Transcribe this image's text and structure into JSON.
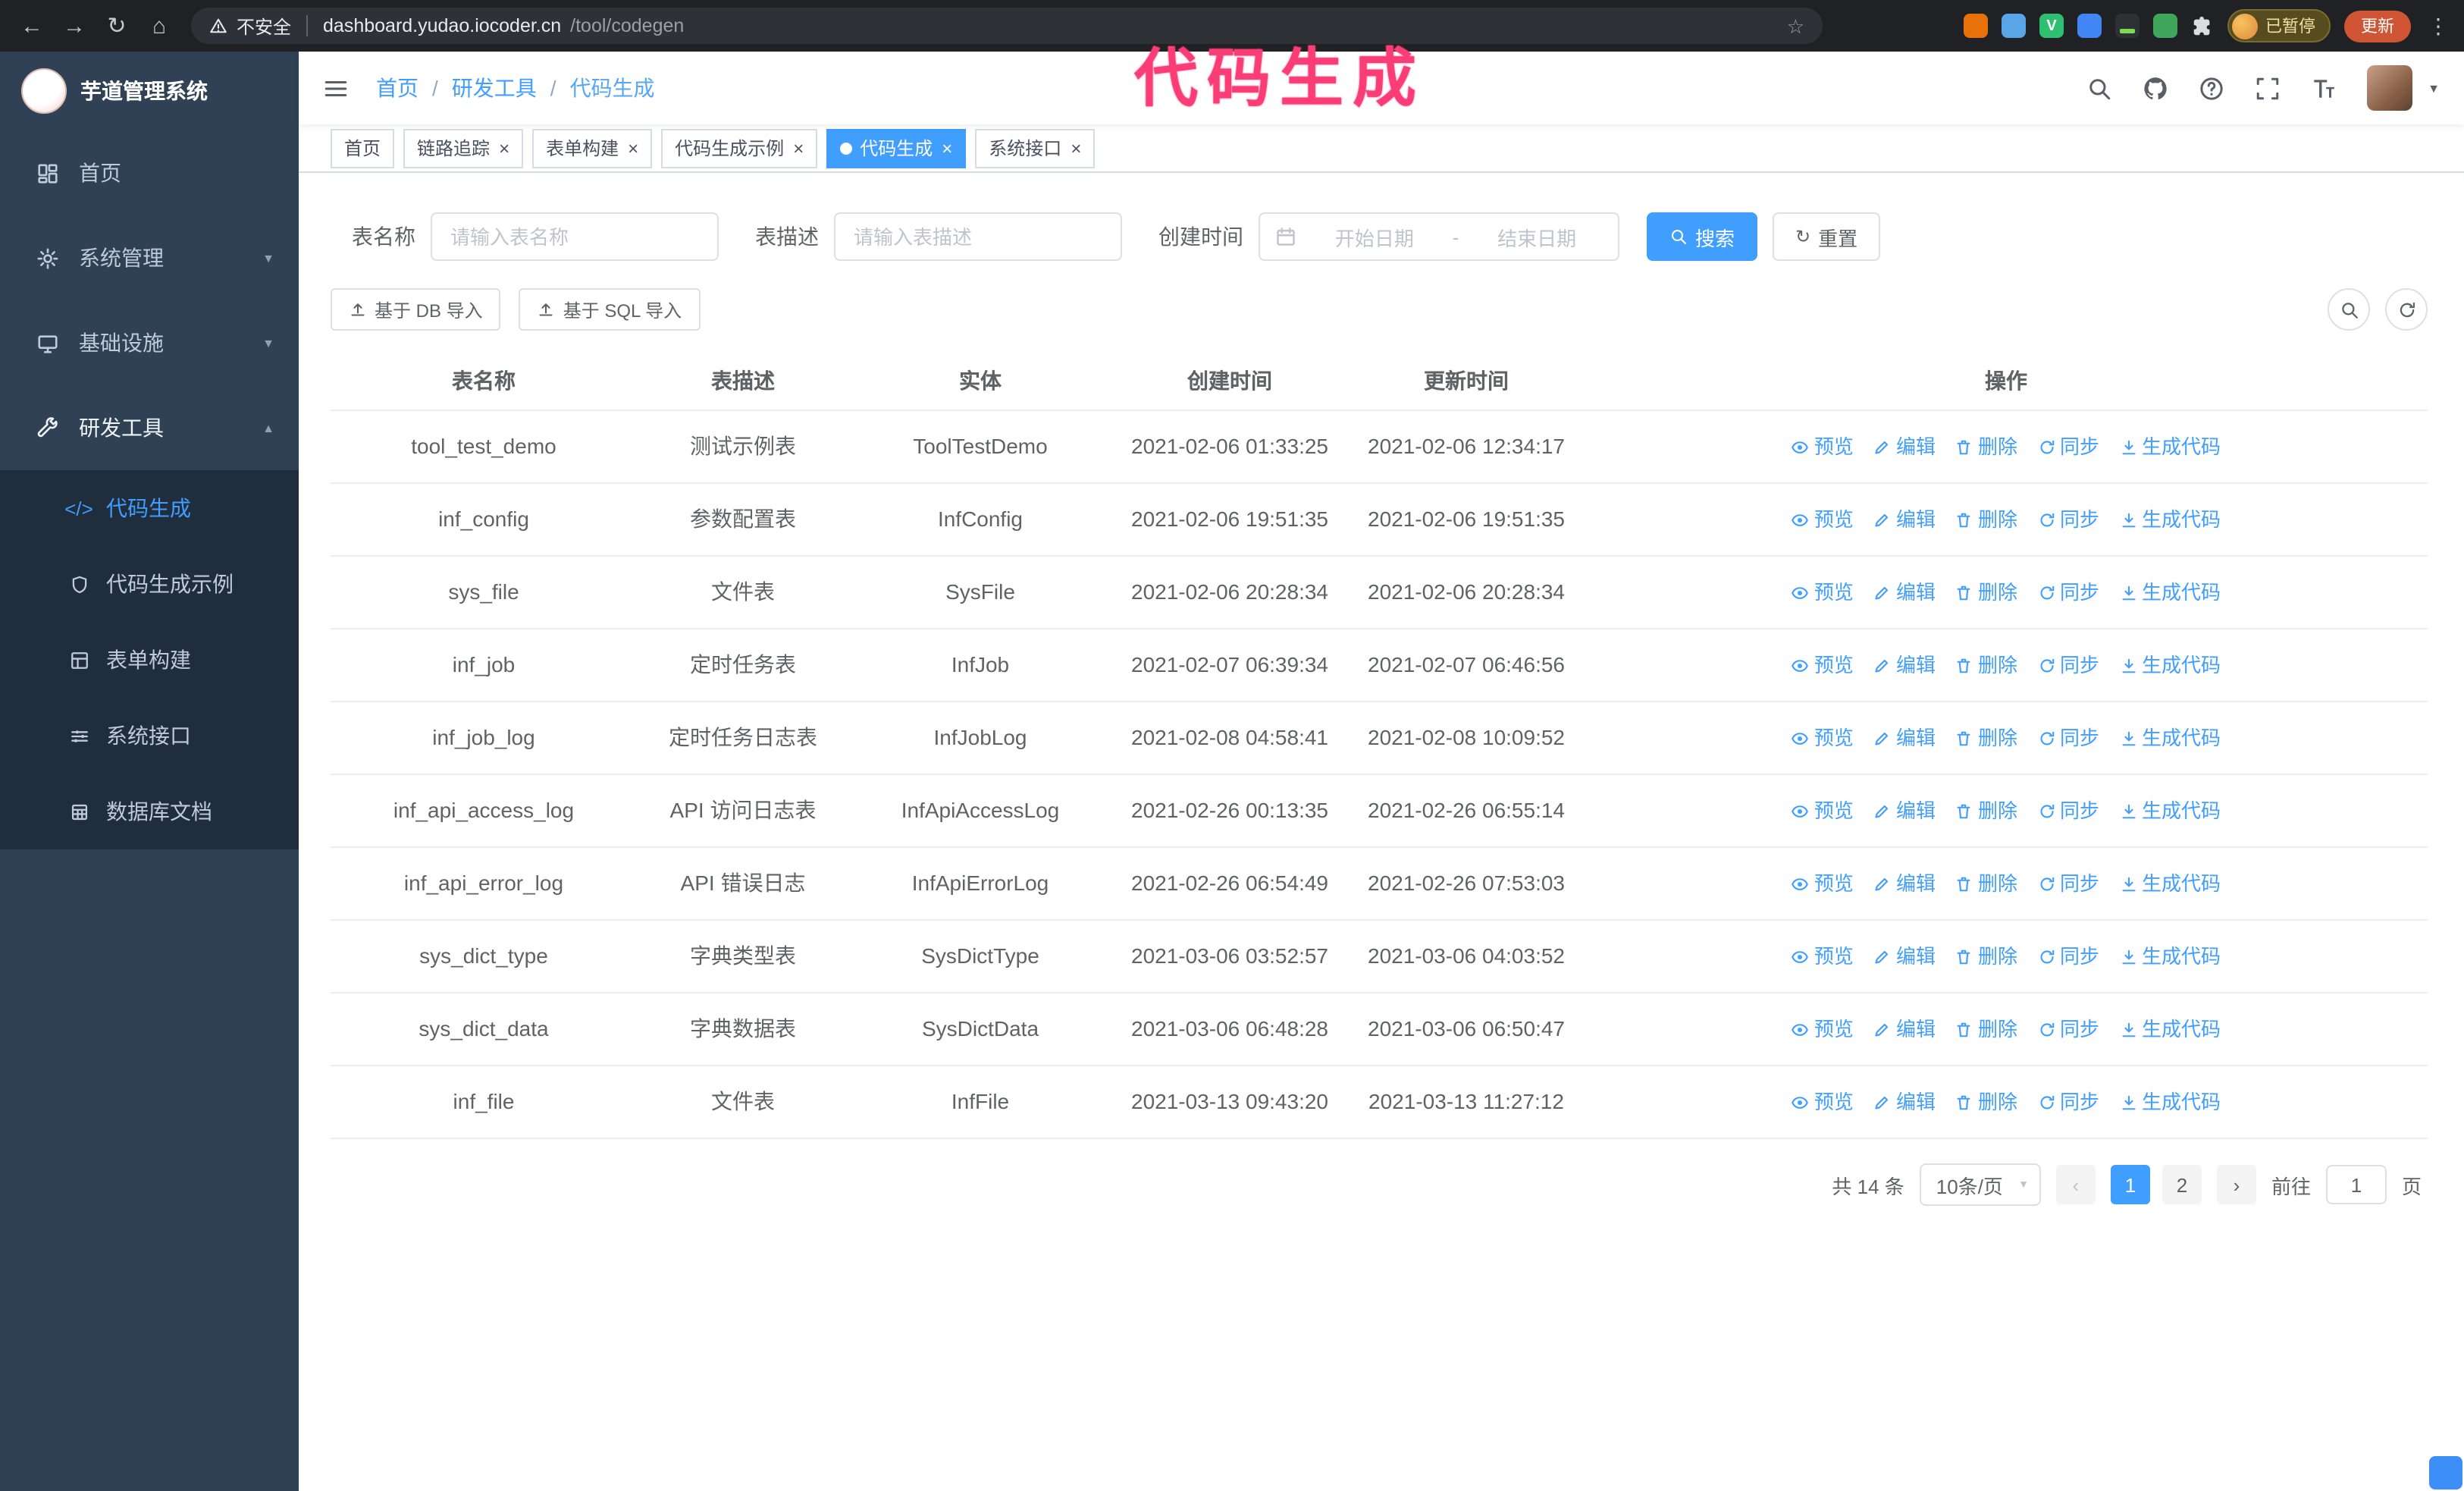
{
  "annotation": {
    "text": "代码生成",
    "color": "#fa3d77"
  },
  "browser": {
    "nav_icons": [
      "back-icon",
      "forward-icon",
      "refresh-icon",
      "home-icon"
    ],
    "security_warning": "不安全",
    "url_host": "dashboard.yudao.iocoder.cn",
    "url_path": "/tool/codegen",
    "bookmark_icon": "star-icon",
    "extensions": [
      {
        "name": "extension-1-icon",
        "color": "#e8710a"
      },
      {
        "name": "extension-2-icon",
        "color": "#58a6e8"
      },
      {
        "name": "extension-3-icon",
        "color": "#2fbf71",
        "glyph": "V"
      },
      {
        "name": "extension-4-icon",
        "color": "#4285f4"
      },
      {
        "name": "extension-5-icon",
        "color": "#2d3134",
        "accent": "#7ed957"
      },
      {
        "name": "extension-6-icon",
        "color": "#3fa65c"
      }
    ],
    "profile_badge": {
      "label": "已暂停"
    },
    "update_button": {
      "label": "更新"
    }
  },
  "sidebar": {
    "logo_title": "芋道管理系统",
    "items": [
      {
        "label": "首页",
        "icon": "dashboard-icon",
        "expandable": false,
        "expanded": false
      },
      {
        "label": "系统管理",
        "icon": "gear-icon",
        "expandable": true,
        "expanded": false
      },
      {
        "label": "基础设施",
        "icon": "monitor-icon",
        "expandable": true,
        "expanded": false
      },
      {
        "label": "研发工具",
        "icon": "tools-icon",
        "expandable": true,
        "expanded": true
      }
    ],
    "subitems": [
      {
        "label": "代码生成",
        "icon": "code-icon",
        "active": true
      },
      {
        "label": "代码生成示例",
        "icon": "shield-icon",
        "active": false
      },
      {
        "label": "表单构建",
        "icon": "form-icon",
        "active": false
      },
      {
        "label": "系统接口",
        "icon": "api-icon",
        "active": false
      },
      {
        "label": "数据库文档",
        "icon": "database-icon",
        "active": false
      }
    ]
  },
  "header": {
    "breadcrumb": [
      {
        "label": "首页"
      },
      {
        "label": "研发工具"
      },
      {
        "label": "代码生成"
      }
    ],
    "right_icons": [
      "search-icon",
      "github-icon",
      "help-icon",
      "fullscreen-icon",
      "font-size-icon"
    ]
  },
  "tabs": [
    {
      "label": "首页",
      "closable": false,
      "active": false
    },
    {
      "label": "链路追踪",
      "closable": true,
      "active": false
    },
    {
      "label": "表单构建",
      "closable": true,
      "active": false
    },
    {
      "label": "代码生成示例",
      "closable": true,
      "active": false
    },
    {
      "label": "代码生成",
      "closable": true,
      "active": true
    },
    {
      "label": "系统接口",
      "closable": true,
      "active": false
    }
  ],
  "filters": {
    "table_name_label": "表名称",
    "table_name_placeholder": "请输入表名称",
    "table_desc_label": "表描述",
    "table_desc_placeholder": "请输入表描述",
    "create_time_label": "创建时间",
    "date_start_placeholder": "开始日期",
    "date_separator": "-",
    "date_end_placeholder": "结束日期",
    "search_button": "搜索",
    "reset_button": "重置"
  },
  "toolbar": {
    "import_db_button": "基于 DB 导入",
    "import_sql_button": "基于 SQL 导入",
    "icon_buttons": [
      "search-toggle-icon",
      "refresh-icon"
    ]
  },
  "table": {
    "columns": [
      "表名称",
      "表描述",
      "实体",
      "创建时间",
      "更新时间",
      "操作"
    ],
    "row_actions": [
      {
        "name": "preview",
        "label": "预览",
        "icon": "eye-icon"
      },
      {
        "name": "edit",
        "label": "编辑",
        "icon": "edit-icon"
      },
      {
        "name": "delete",
        "label": "删除",
        "icon": "delete-icon"
      },
      {
        "name": "sync",
        "label": "同步",
        "icon": "sync-icon"
      },
      {
        "name": "generate-code",
        "label": "生成代码",
        "icon": "download-icon"
      }
    ],
    "rows": [
      {
        "name": "tool_test_demo",
        "desc": "测试示例表",
        "entity": "ToolTestDemo",
        "created": "2021-02-06 01:33:25",
        "updated": "2021-02-06 12:34:17"
      },
      {
        "name": "inf_config",
        "desc": "参数配置表",
        "entity": "InfConfig",
        "created": "2021-02-06 19:51:35",
        "updated": "2021-02-06 19:51:35"
      },
      {
        "name": "sys_file",
        "desc": "文件表",
        "entity": "SysFile",
        "created": "2021-02-06 20:28:34",
        "updated": "2021-02-06 20:28:34"
      },
      {
        "name": "inf_job",
        "desc": "定时任务表",
        "entity": "InfJob",
        "created": "2021-02-07 06:39:34",
        "updated": "2021-02-07 06:46:56"
      },
      {
        "name": "inf_job_log",
        "desc": "定时任务日志表",
        "entity": "InfJobLog",
        "created": "2021-02-08 04:58:41",
        "updated": "2021-02-08 10:09:52"
      },
      {
        "name": "inf_api_access_log",
        "desc": "API 访问日志表",
        "entity": "InfApiAccessLog",
        "created": "2021-02-26 00:13:35",
        "updated": "2021-02-26 06:55:14"
      },
      {
        "name": "inf_api_error_log",
        "desc": "API 错误日志",
        "entity": "InfApiErrorLog",
        "created": "2021-02-26 06:54:49",
        "updated": "2021-02-26 07:53:03"
      },
      {
        "name": "sys_dict_type",
        "desc": "字典类型表",
        "entity": "SysDictType",
        "created": "2021-03-06 03:52:57",
        "updated": "2021-03-06 04:03:52"
      },
      {
        "name": "sys_dict_data",
        "desc": "字典数据表",
        "entity": "SysDictData",
        "created": "2021-03-06 06:48:28",
        "updated": "2021-03-06 06:50:47"
      },
      {
        "name": "inf_file",
        "desc": "文件表",
        "entity": "InfFile",
        "created": "2021-03-13 09:43:20",
        "updated": "2021-03-13 11:27:12"
      }
    ]
  },
  "pagination": {
    "total": "共 14 条",
    "page_size": "10条/页",
    "pages": [
      "1",
      "2"
    ],
    "active_page": "1",
    "goto_label": "前往",
    "goto_value": "1",
    "goto_unit": "页"
  },
  "colors": {
    "accent": "#409eff",
    "sidebar_bg": "#304156",
    "submenu_bg": "#1f2d3d",
    "annotation": "#fa3d77",
    "chrome_bg": "#202124"
  }
}
